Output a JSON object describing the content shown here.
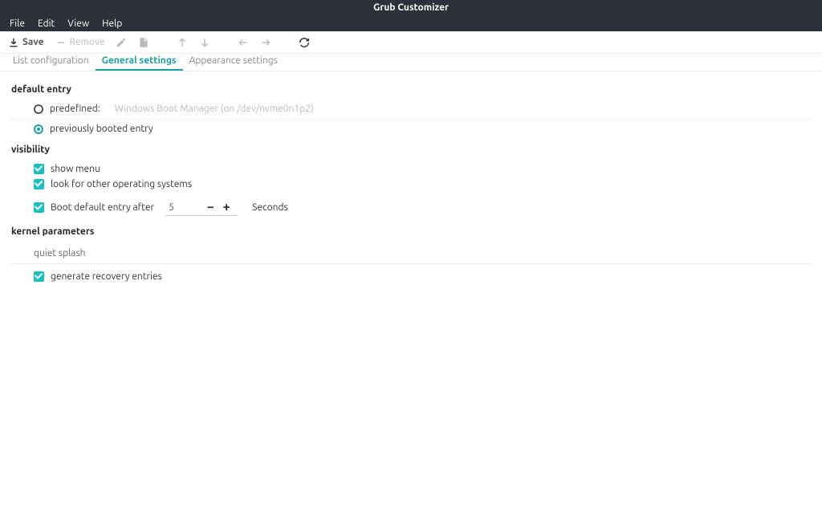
{
  "window": {
    "title": "Grub Customizer"
  },
  "menubar": {
    "file": "File",
    "edit": "Edit",
    "view": "View",
    "help": "Help"
  },
  "toolbar": {
    "save": "Save",
    "remove": "Remove"
  },
  "tabs": {
    "list": "List configuration",
    "general": "General settings",
    "appearance": "Appearance settings"
  },
  "sections": {
    "default_entry": {
      "title": "default entry",
      "predefined_label": "predefined:",
      "predefined_value": "Windows Boot Manager (on /dev/nvme0n1p2)",
      "previous_label": "previously booted entry"
    },
    "visibility": {
      "title": "visibility",
      "show_menu": "show menu",
      "look_other": "look for other operating systems",
      "boot_after": "Boot default entry after",
      "timeout_value": "5",
      "seconds": "Seconds"
    },
    "kernel": {
      "title": "kernel parameters",
      "params": "quiet splash",
      "recovery": "generate recovery entries"
    }
  }
}
